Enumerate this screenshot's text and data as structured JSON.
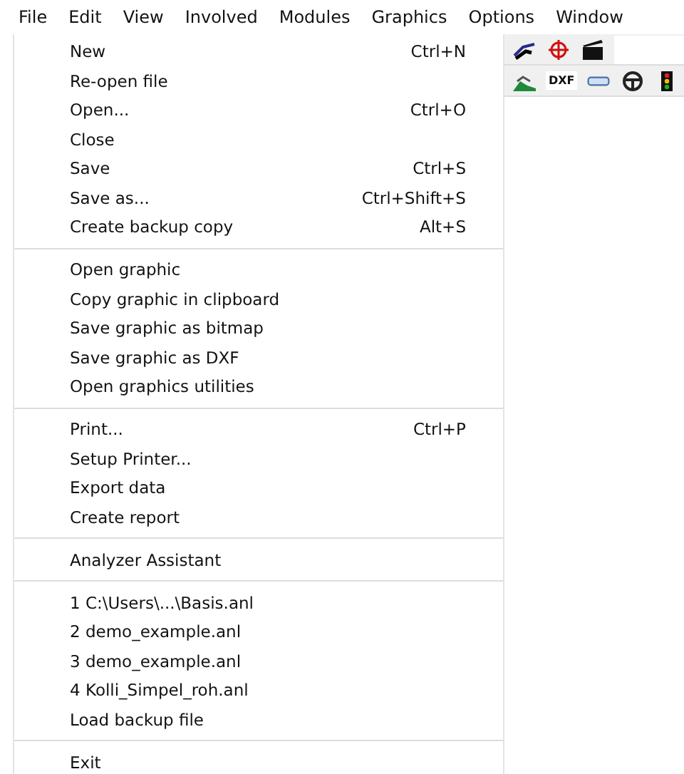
{
  "menu_bar": [
    "File",
    "Edit",
    "View",
    "Involved",
    "Modules",
    "Graphics",
    "Options",
    "Window"
  ],
  "file_menu": [
    [
      {
        "label": "New",
        "shortcut": "Ctrl+N"
      },
      {
        "label": "Re-open file"
      },
      {
        "label": "Open...",
        "shortcut": "Ctrl+O"
      },
      {
        "label": "Close"
      },
      {
        "label": "Save",
        "shortcut": "Ctrl+S"
      },
      {
        "label": "Save as...",
        "shortcut": "Ctrl+Shift+S"
      },
      {
        "label": "Create backup copy",
        "shortcut": "Alt+S"
      }
    ],
    [
      {
        "label": "Open graphic"
      },
      {
        "label": "Copy graphic in clipboard"
      },
      {
        "label": "Save graphic as bitmap"
      },
      {
        "label": "Save graphic as DXF"
      },
      {
        "label": "Open graphics utilities"
      }
    ],
    [
      {
        "label": "Print...",
        "shortcut": "Ctrl+P"
      },
      {
        "label": "Setup Printer..."
      },
      {
        "label": "Export data"
      },
      {
        "label": "Create report"
      }
    ],
    [
      {
        "label": "Analyzer Assistant"
      }
    ],
    [
      {
        "label": "1 C:\\Users\\...\\Basis.anl"
      },
      {
        "label": "2 demo_example.anl"
      },
      {
        "label": "3 demo_example.anl"
      },
      {
        "label": "4 Kolli_Simpel_roh.anl"
      },
      {
        "label": "Load backup file"
      }
    ],
    [
      {
        "label": "Exit"
      }
    ]
  ],
  "toolbar": {
    "dxf_button": "DXF"
  }
}
